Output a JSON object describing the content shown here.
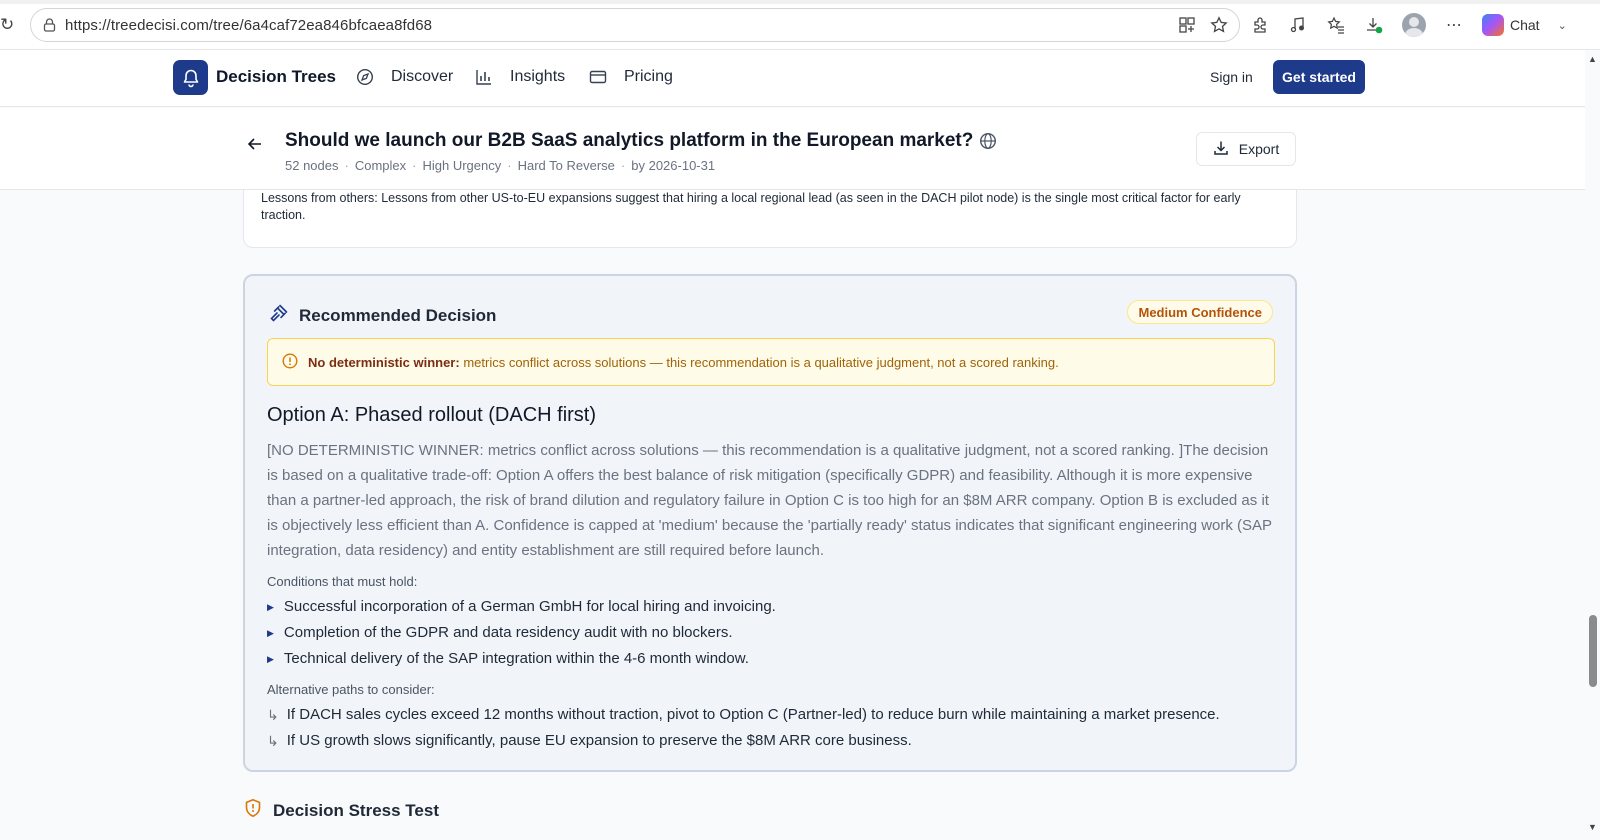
{
  "browser": {
    "url": "https://treedecisi.com/tree/6a4caf72ea846bfcaea8fd68",
    "chat_label": "Chat"
  },
  "header": {
    "brand": "Decision Trees",
    "nav": [
      {
        "label": "Discover"
      },
      {
        "label": "Insights"
      },
      {
        "label": "Pricing"
      }
    ],
    "sign_in": "Sign in",
    "get_started": "Get started"
  },
  "tree": {
    "title": "Should we launch our B2B SaaS analytics platform in the European market?",
    "meta": [
      "52 nodes",
      "Complex",
      "High Urgency",
      "Hard To Reverse",
      "by 2026-10-31"
    ],
    "export_label": "Export"
  },
  "lessons": {
    "text": "Lessons from others: Lessons from other US-to-EU expansions suggest that hiring a local regional lead (as seen in the DACH pilot node) is the single most critical factor for early traction."
  },
  "recommendation": {
    "title": "Recommended Decision",
    "confidence": "Medium Confidence",
    "warning_bold": "No deterministic winner:",
    "warning_text": "metrics conflict across solutions — this recommendation is a qualitative judgment, not a scored ranking.",
    "option_title": "Option A: Phased rollout (DACH first)",
    "rationale": "[NO DETERMINISTIC WINNER: metrics conflict across solutions — this recommendation is a qualitative judgment, not a scored ranking. ]The decision is based on a qualitative trade-off: Option A offers the best balance of risk mitigation (specifically GDPR) and feasibility. Although it is more expensive than a partner-led approach, the risk of brand dilution and regulatory failure in Option C is too high for an $8M ARR company. Option B is excluded as it is objectively less efficient than A. Confidence is capped at 'medium' because the 'partially ready' status indicates that significant engineering work (SAP integration, data residency) and entity establishment are still required before launch.",
    "conditions_label": "Conditions that must hold:",
    "conditions": [
      "Successful incorporation of a German GmbH for local hiring and invoicing.",
      "Completion of the GDPR and data residency audit with no blockers.",
      "Technical delivery of the SAP integration within the 4-6 month window."
    ],
    "alternatives_label": "Alternative paths to consider:",
    "alternatives": [
      "If DACH sales cycles exceed 12 months without traction, pivot to Option C (Partner-led) to reduce burn while maintaining a market presence.",
      "If US growth slows significantly, pause EU expansion to preserve the $8M ARR core business."
    ]
  },
  "stress_test": {
    "title": "Decision Stress Test"
  },
  "colors": {
    "brand": "#1e3a8a",
    "confidence": "#b45309",
    "warning_bg": "#fefce8"
  }
}
